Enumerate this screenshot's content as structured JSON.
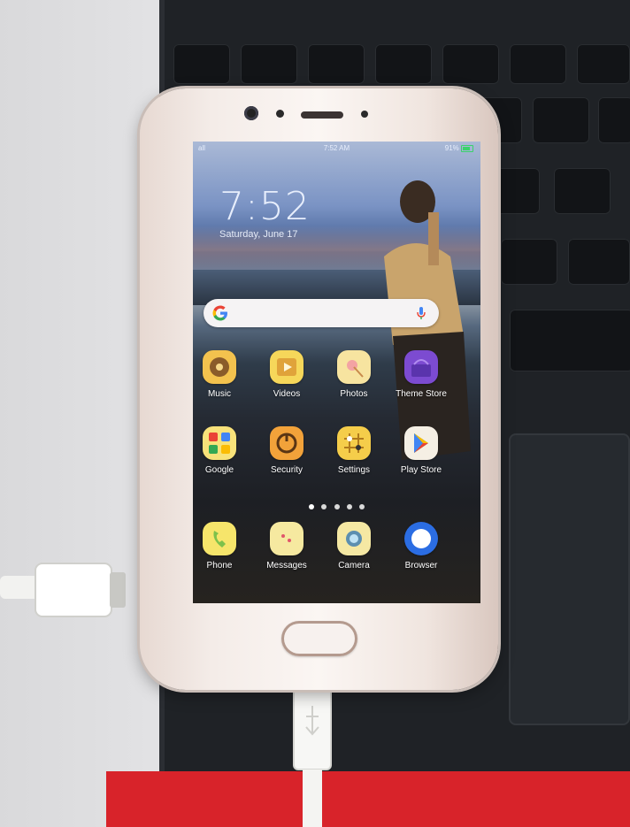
{
  "status_bar": {
    "left": "all",
    "time": "7:52 AM",
    "right": "91%"
  },
  "lockscreen": {
    "clock": "7:52",
    "date": "Saturday, June 17"
  },
  "search_bar": {
    "logo": "G",
    "icon": "mic-icon"
  },
  "apps_row1": [
    {
      "label": "Music",
      "icon": "music-icon",
      "color": "#f3c24e"
    },
    {
      "label": "Videos",
      "icon": "videos-icon",
      "color": "#f6d75a"
    },
    {
      "label": "Photos",
      "icon": "photos-icon",
      "color": "#f7e4a0"
    },
    {
      "label": "Theme Store",
      "icon": "theme-store-icon",
      "color": "#7c4bd1"
    }
  ],
  "apps_row2": [
    {
      "label": "Google",
      "icon": "google-folder-icon",
      "color": "#f8e27a"
    },
    {
      "label": "Security",
      "icon": "security-icon",
      "color": "#f2a23a"
    },
    {
      "label": "Settings",
      "icon": "settings-icon",
      "color": "#f5cd4a"
    },
    {
      "label": "Play Store",
      "icon": "play-store-icon",
      "color": "#f5efe4"
    }
  ],
  "page_indicator": {
    "count": 5,
    "active": 1
  },
  "dock": [
    {
      "label": "Phone",
      "icon": "phone-icon",
      "color": "#f6e56b"
    },
    {
      "label": "Messages",
      "icon": "messages-icon",
      "color": "#f6e9a0"
    },
    {
      "label": "Camera",
      "icon": "camera-icon",
      "color": "#f5e8a3"
    },
    {
      "label": "Browser",
      "icon": "browser-icon",
      "color": "#2b6de3"
    }
  ]
}
